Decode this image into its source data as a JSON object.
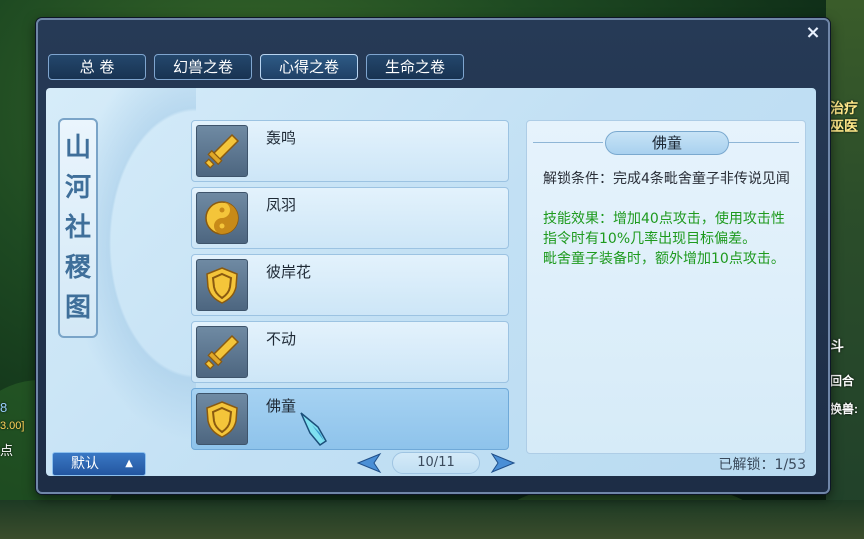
{
  "window": {
    "close_label": "×",
    "tabs": [
      {
        "label": "总 卷"
      },
      {
        "label": "幻兽之卷"
      },
      {
        "label": "心得之卷"
      },
      {
        "label": "生命之卷"
      }
    ],
    "scroll_title_chars": [
      "山",
      "河",
      "社",
      "稷",
      "图"
    ]
  },
  "list": {
    "items": [
      {
        "name": "轰鸣",
        "icon": "sword-icon"
      },
      {
        "name": "凤羽",
        "icon": "yin-yang-icon"
      },
      {
        "name": "彼岸花",
        "icon": "shield-icon"
      },
      {
        "name": "不动",
        "icon": "sword-icon"
      },
      {
        "name": "佛童",
        "icon": "shield-icon"
      }
    ]
  },
  "detail": {
    "title": "佛童",
    "unlock_condition": "解锁条件：完成4条毗舍童子非传说见闻",
    "effect": "技能效果：增加40点攻击，使用攻击性指令时有10%几率出现目标偏差。",
    "effect_extra": "毗舍童子装备时，额外增加10点攻击。"
  },
  "bottom": {
    "default_label": "默认",
    "default_arrow": "▲",
    "page": "10/11",
    "unlocked": "已解锁：1/53"
  },
  "background_text": {
    "right_1": "治疗",
    "right_2": "巫医",
    "right_3": "斗",
    "right_4": "回合",
    "right_5": "换兽:",
    "left_1": "8",
    "left_2": "3.00]",
    "left_3": "点"
  },
  "colors": {
    "effect_green": "#1e9a1e",
    "tab_border": "#7fa5cf",
    "panel_bg": "#d6ecf9"
  }
}
